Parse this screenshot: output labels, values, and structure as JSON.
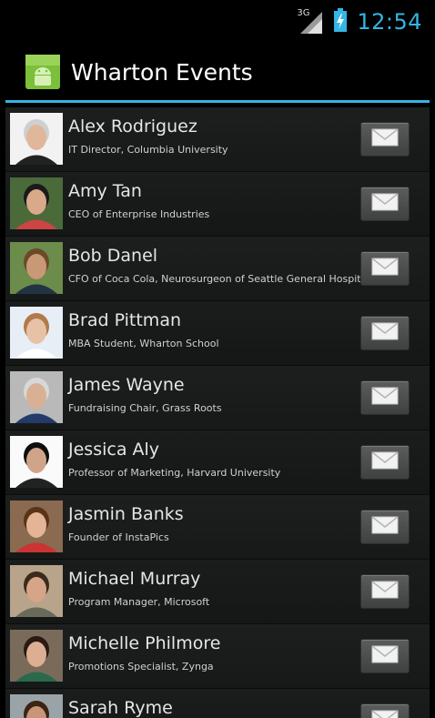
{
  "status": {
    "network": "3G",
    "time": "12:54"
  },
  "app": {
    "title": "Wharton Events"
  },
  "people": [
    {
      "name": "Alex Rodriguez",
      "title": "IT Director, Columbia University"
    },
    {
      "name": "Amy Tan",
      "title": "CEO of Enterprise Industries"
    },
    {
      "name": "Bob Danel",
      "title": "CFO of Coca Cola, Neurosurgeon of Seattle General Hospital"
    },
    {
      "name": "Brad Pittman",
      "title": "MBA Student, Wharton School"
    },
    {
      "name": "James Wayne",
      "title": "Fundraising Chair, Grass Roots"
    },
    {
      "name": "Jessica Aly",
      "title": "Professor of Marketing, Harvard University"
    },
    {
      "name": "Jasmin Banks",
      "title": "Founder of InstaPics"
    },
    {
      "name": "Michael Murray",
      "title": "Program Manager, Microsoft"
    },
    {
      "name": "Michelle Philmore",
      "title": "Promotions Specialist, Zynga"
    },
    {
      "name": "Sarah Ryme",
      "title": ""
    }
  ],
  "colors": {
    "accent": "#33b5e5",
    "background": "#000000"
  }
}
